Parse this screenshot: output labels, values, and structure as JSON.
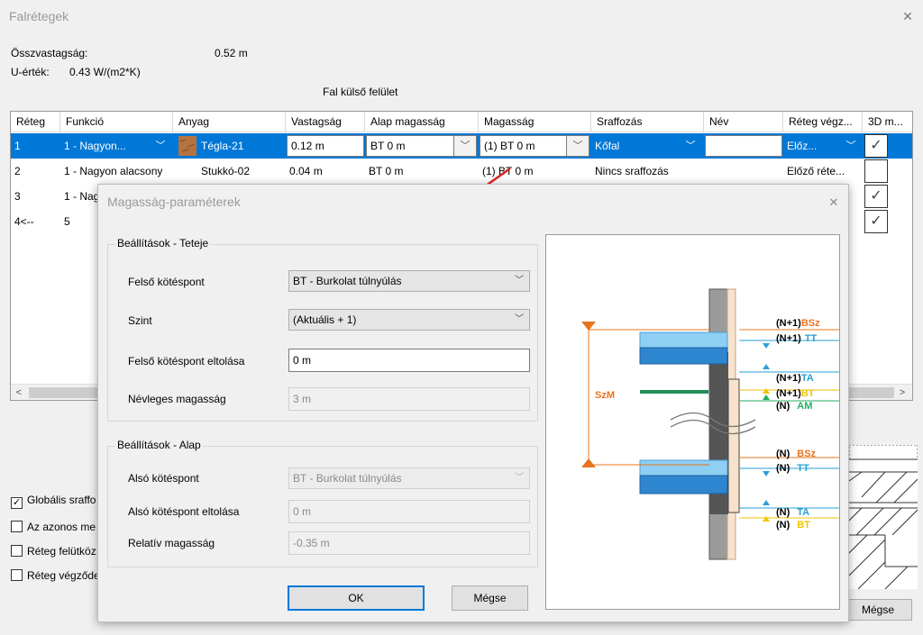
{
  "window": {
    "title": "Falrétegek",
    "close_glyph": "✕",
    "thickness_label": "Összvastagság:",
    "thickness_value": "0.52 m",
    "u_label": "U-érték:",
    "u_value": "0.43 W/(m2*K)",
    "surface_label": "Fal külső felület"
  },
  "table": {
    "columns": [
      "Réteg",
      "Funkció",
      "Anyag",
      "Vastagság",
      "Alap magasság",
      "Magasság",
      "Sraffozás",
      "Név",
      "Réteg végz...",
      "3D m..."
    ],
    "rows": [
      {
        "layer": "1",
        "function": "1 - Nagyon...",
        "material": "Tégla-21",
        "thickness": "0.12 m",
        "base": "BT 0 m",
        "height": "(1) BT 0 m",
        "hatch": "Kőfal",
        "name": "",
        "end": "Előz...",
        "checked": true
      },
      {
        "layer": "2",
        "function": "1 - Nagyon alacsony",
        "material": "Stukkó-02",
        "thickness": "0.04 m",
        "base": "BT 0 m",
        "height": "(1) BT 0 m",
        "hatch": "Nincs sraffozás",
        "name": "",
        "end": "Előző réte...",
        "checked": false
      },
      {
        "layer": "3",
        "function": "1 - Nag",
        "checked": true
      },
      {
        "layer": "4<--",
        "function": "5",
        "checked": true
      }
    ],
    "check_glyph": "✓",
    "dropdown_glyph": "﹀",
    "scroll_left": "<",
    "scroll_right": ">"
  },
  "checkboxes": [
    {
      "label": "Globális sraffo",
      "checked": true
    },
    {
      "label": "Az azonos me",
      "checked": false
    },
    {
      "label": "Réteg felütköz",
      "checked": false
    },
    {
      "label": "Réteg végződe",
      "checked": false
    }
  ],
  "background_cancel": "Mégse",
  "dialog": {
    "title": "Magasság-paraméterek",
    "close_glyph": "✕",
    "top_group": {
      "legend": "Beállítások - Teteje",
      "top_anchor_label": "Felső kötéspont",
      "top_anchor_value": "BT - Burkolat túlnyúlás",
      "level_label": "Szint",
      "level_value": "(Aktuális + 1)",
      "offset_label": "Felső kötéspont eltolása",
      "offset_value": "0 m",
      "nominal_label": "Névleges magasság",
      "nominal_value": "3 m"
    },
    "base_group": {
      "legend": "Beállítások - Alap",
      "bottom_anchor_label": "Alsó kötéspont",
      "bottom_anchor_value": "BT - Burkolat túlnyúlás",
      "bottom_offset_label": "Alsó kötéspont eltolása",
      "bottom_offset_value": "0 m",
      "relative_label": "Relatív magasság",
      "relative_value": "-0.35 m"
    },
    "ok_label": "OK",
    "cancel_label": "Mégse",
    "chevron": "﹀"
  },
  "diagram": {
    "szm": "SzM",
    "labels_top": [
      {
        "prefix": "(N+1)",
        "code": "BSz",
        "color": "#e8741e"
      },
      {
        "prefix": "(N+1)",
        "code": "TT",
        "color": "#2a9fd6"
      },
      {
        "prefix": "(N+1)",
        "code": "TA",
        "color": "#2a9fd6"
      },
      {
        "prefix": "(N+1)",
        "code": "BT",
        "color": "#f2c200"
      },
      {
        "prefix": "(N)",
        "code": "AM",
        "color": "#27ae60"
      }
    ],
    "labels_bottom": [
      {
        "prefix": "(N)",
        "code": "BSz",
        "color": "#e8741e"
      },
      {
        "prefix": "(N)",
        "code": "TT",
        "color": "#2a9fd6"
      },
      {
        "prefix": "(N)",
        "code": "TA",
        "color": "#2a9fd6"
      },
      {
        "prefix": "(N)",
        "code": "BT",
        "color": "#f2c200"
      }
    ]
  },
  "colors": {
    "selection": "#0078d7",
    "arrow": "#e02020",
    "brick": "#b5733f"
  }
}
